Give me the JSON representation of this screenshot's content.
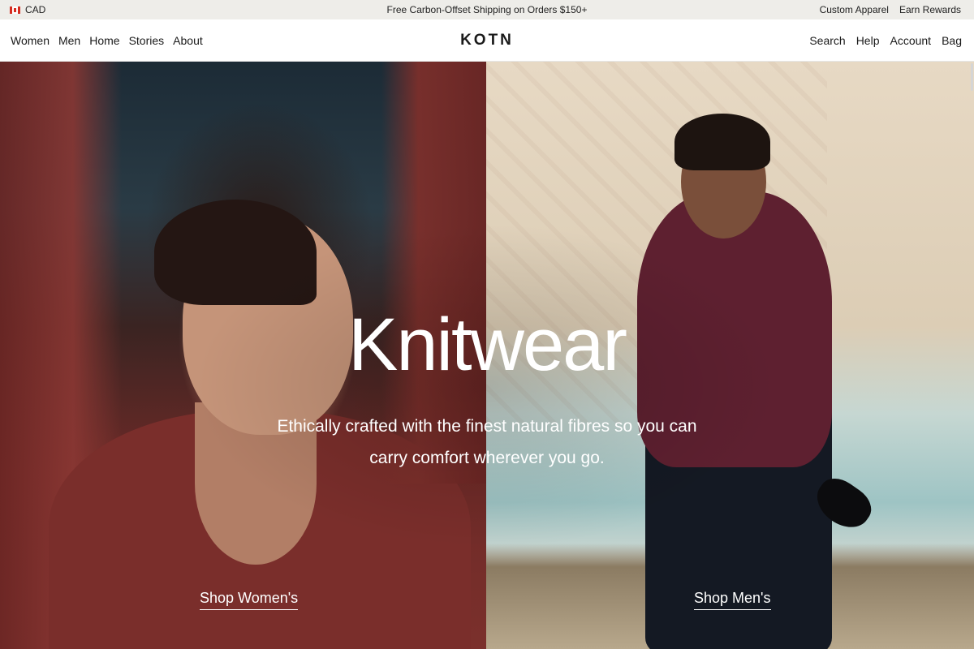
{
  "announcement": {
    "currency": "CAD",
    "promo": "Free Carbon-Offset Shipping on Orders $150+",
    "links": [
      "Custom Apparel",
      "Earn Rewards"
    ]
  },
  "header": {
    "logo": "KOTN",
    "nav_left": [
      "Women",
      "Men",
      "Home",
      "Stories",
      "About"
    ],
    "nav_right": [
      "Search",
      "Help",
      "Account",
      "Bag"
    ]
  },
  "hero": {
    "headline": "Knitwear",
    "subtext": "Ethically crafted with the finest natural fibres so you can carry comfort wherever you go.",
    "cta_women": "Shop Women's",
    "cta_men": "Shop Men's"
  },
  "icons": {
    "flag": "canada-flag-icon"
  },
  "colors": {
    "announcement_bg": "#eeede9",
    "text_dark": "#1a1a1a",
    "hero_text": "#ffffff"
  }
}
